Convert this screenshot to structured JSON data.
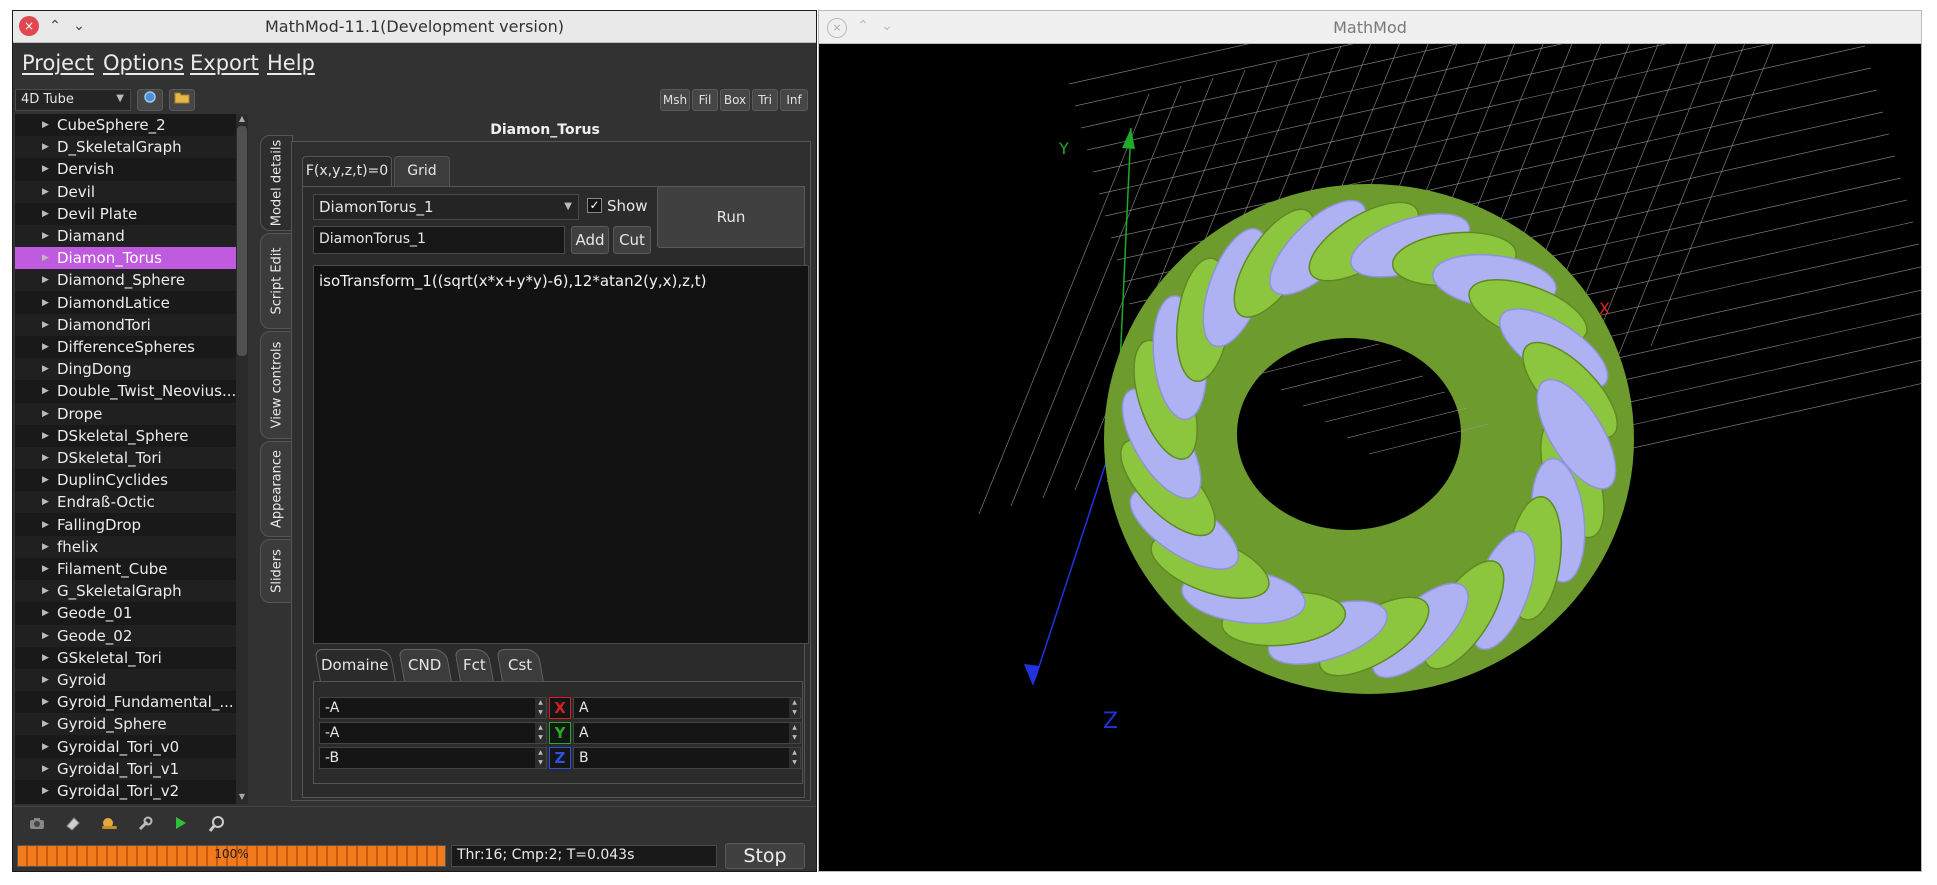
{
  "left_window": {
    "title": "MathMod-11.1(Development version)",
    "close_glyph": "×",
    "minimize_glyph": "⌃",
    "maximize_glyph": "⌄"
  },
  "menu": [
    "Project",
    "Options",
    "Export",
    "Help"
  ],
  "toolbar": {
    "model_combo": "4D Tube",
    "combo_arrow": "▼",
    "right_buttons": [
      "Msh",
      "Fil",
      "Box",
      "Tri",
      "Inf"
    ]
  },
  "model_list": {
    "selected": "Diamon_Torus",
    "items": [
      "CubeSphere_2",
      "D_SkeletalGraph",
      "Dervish",
      "Devil",
      "Devil Plate",
      "Diamand",
      "Diamon_Torus",
      "Diamond_Sphere",
      "DiamondLatice",
      "DiamondTori",
      "DifferenceSpheres",
      "DingDong",
      "Double_Twist_Neovius...",
      "Drope",
      "DSkeletal_Sphere",
      "DSkeletal_Tori",
      "DuplinCyclides",
      "Endraß-Octic",
      "FallingDrop",
      "fhelix",
      "Filament_Cube",
      "G_SkeletalGraph",
      "Geode_01",
      "Geode_02",
      "GSkeletal_Tori",
      "Gyroid",
      "Gyroid_Fundamental_...",
      "Gyroid_Sphere",
      "Gyroidal_Tori_v0",
      "Gyroidal_Tori_v1",
      "Gyroidal_Tori_v2"
    ]
  },
  "side_tabs": [
    "Model details",
    "Script Edit",
    "View controls",
    "Appearance",
    "Sliders"
  ],
  "panel": {
    "title": "Diamon_Torus",
    "tabs": [
      "F(x,y,z,t)=0",
      "Grid"
    ],
    "component_combo": "DiamonTorus_1",
    "show_label": "Show",
    "show_checked": true,
    "check_glyph": "✓",
    "run_label": "Run",
    "name_field": "DiamonTorus_1",
    "add_label": "Add",
    "cut_label": "Cut",
    "formula": "isoTransform_1((sqrt(x*x+y*y)-6),12*atan2(y,x),z,t)"
  },
  "domain": {
    "tabs": [
      "Domaine",
      "CND",
      "Fct",
      "Cst"
    ],
    "rows": [
      {
        "min": "-A",
        "axis": "X",
        "max": "A",
        "color": "#d02020"
      },
      {
        "min": "-A",
        "axis": "Y",
        "max": "A",
        "color": "#20b020"
      },
      {
        "min": "-B",
        "axis": "Z",
        "max": "B",
        "color": "#3050e0"
      }
    ]
  },
  "bottom_icons": [
    "camera-icon",
    "eraser-icon",
    "snail-icon",
    "wrench-icon",
    "play-icon",
    "zoom-icon"
  ],
  "status": {
    "progress_label": "100%",
    "progress_fraction": 1.0,
    "info": "Thr:16; Cmp:2; T=0.043s",
    "stop_label": "Stop"
  },
  "right_window": {
    "title": "MathMod",
    "close_glyph": "×",
    "up_glyph": "⌃",
    "down_glyph": "⌄"
  },
  "viewport": {
    "axis_labels": [
      "Y",
      "X",
      "Z"
    ],
    "colors": {
      "background": "#000000",
      "green": "#8cc63f",
      "lavender": "#aeb2f2",
      "grid": "#9a9a9a"
    }
  },
  "colors": {
    "accent": "#c05bdf",
    "progress": "#f07a1c"
  }
}
